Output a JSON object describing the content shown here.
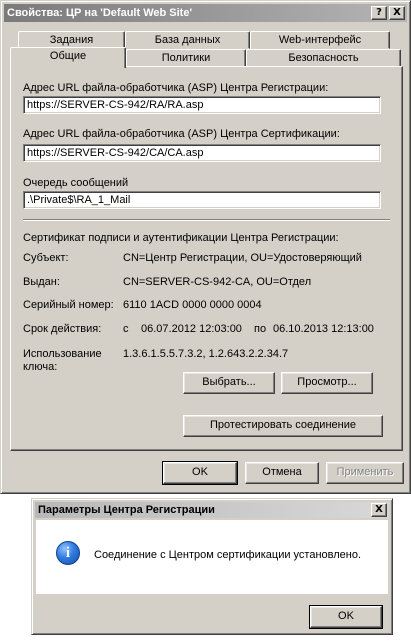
{
  "main_window": {
    "title": "Свойства: ЦР на 'Default Web Site'",
    "help_btn": "?",
    "close_btn": "X",
    "tabs_row1": [
      "Задания",
      "База данных",
      "Web-интерфейс"
    ],
    "tabs_row2": [
      "Общие",
      "Политики",
      "Безопасность"
    ],
    "active_tab": "Общие",
    "ra_url_label": "Адрес URL файла-обработчика (ASP) Центра Регистрации:",
    "ra_url_value": "https://SERVER-CS-942/RA/RA.asp",
    "ca_url_label": "Адрес URL файла-обработчика (ASP) Центра Сертификации:",
    "ca_url_value": "https://SERVER-CS-942/CA/CA.asp",
    "queue_label": "Очередь сообщений",
    "queue_value": ".\\Private$\\RA_1_Mail",
    "cert": {
      "heading": "Сертификат подписи и аутентификации Центра Регистрации:",
      "subject_label": "Субъект:",
      "subject_value": "CN=Центр Регистрации, OU=Удостоверяющий",
      "issuer_label": "Выдан:",
      "issuer_value": "CN=SERVER-CS-942-CA, OU=Отдел",
      "serial_label": "Серийный номер:",
      "serial_value": "6110 1ACD 0000 0000 0004",
      "validity_label": "Срок действия:",
      "validity_from_word": "с",
      "validity_from": "06.07.2012 12:03:00",
      "validity_to_word": "по",
      "validity_to": "06.10.2013 12:13:00",
      "usage_label_1": "Использование",
      "usage_label_2": "ключа:",
      "usage_value": "1.3.6.1.5.5.7.3.2, 1.2.643.2.2.34.7"
    },
    "buttons": {
      "select": "Выбрать...",
      "view": "Просмотр...",
      "test_connection": "Протестировать соединение",
      "ok": "OK",
      "cancel": "Отмена",
      "apply": "Применить"
    }
  },
  "dialog": {
    "title": "Параметры Центра Регистрации",
    "close_btn": "X",
    "icon": "info-icon",
    "message": "Соединение с Центром сертификации установлено.",
    "ok": "OK"
  },
  "colors": {
    "face": "#d4d0c8",
    "title_inactive": "#7a7a7a",
    "info_blue": "#2f7be0"
  }
}
